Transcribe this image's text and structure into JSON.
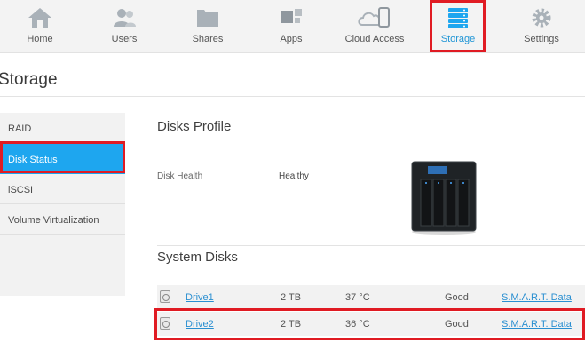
{
  "nav": [
    {
      "label": "Home",
      "icon": "home-icon"
    },
    {
      "label": "Users",
      "icon": "users-icon"
    },
    {
      "label": "Shares",
      "icon": "folder-icon"
    },
    {
      "label": "Apps",
      "icon": "apps-icon"
    },
    {
      "label": "Cloud Access",
      "icon": "cloud-access-icon"
    },
    {
      "label": "Storage",
      "icon": "storage-icon",
      "active": true
    },
    {
      "label": "Settings",
      "icon": "gear-icon"
    }
  ],
  "page": {
    "title": "Storage"
  },
  "sidebar": {
    "items": [
      {
        "label": "RAID"
      },
      {
        "label": "Disk Status",
        "active": true
      },
      {
        "label": "iSCSI"
      },
      {
        "label": "Volume Virtualization"
      }
    ]
  },
  "disks_profile": {
    "title": "Disks Profile",
    "health_label": "Disk Health",
    "health_value": "Healthy"
  },
  "system_disks": {
    "title": "System Disks",
    "rows": [
      {
        "name": "Drive1",
        "size": "2 TB",
        "temp": "37 °C",
        "status": "Good",
        "smart": "S.M.A.R.T. Data"
      },
      {
        "name": "Drive2",
        "size": "2 TB",
        "temp": "36 °C",
        "status": "Good",
        "smart": "S.M.A.R.T. Data"
      }
    ]
  },
  "colors": {
    "accent": "#1ea6ef",
    "highlight": "#e01b23",
    "link": "#2a8fd1"
  }
}
